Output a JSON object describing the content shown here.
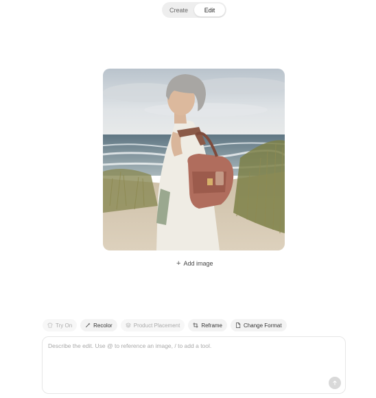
{
  "mode_toggle": {
    "options": [
      "Create",
      "Edit"
    ],
    "selected": "Edit"
  },
  "image_preview": {
    "icon": "photo-of-woman-with-handbag-on-beach"
  },
  "add_image": {
    "label": "Add image",
    "icon": "plus-icon"
  },
  "tools": [
    {
      "label": "Try On",
      "icon": "shirt-icon",
      "enabled": false
    },
    {
      "label": "Recolor",
      "icon": "magic-wand-icon",
      "enabled": true
    },
    {
      "label": "Product Placement",
      "icon": "layers-icon",
      "enabled": false
    },
    {
      "label": "Reframe",
      "icon": "crop-icon",
      "enabled": true
    },
    {
      "label": "Change Format",
      "icon": "file-icon",
      "enabled": true
    }
  ],
  "prompt": {
    "value": "",
    "placeholder": "Describe the edit. Use @ to reference an image, / to add a tool."
  },
  "send_button": {
    "icon": "arrow-up-icon",
    "enabled": false
  },
  "colors": {
    "toggle_bg": "#eeeeee",
    "chip_bg": "#f3f3f3",
    "send_disabled": "#d9d9d9"
  }
}
